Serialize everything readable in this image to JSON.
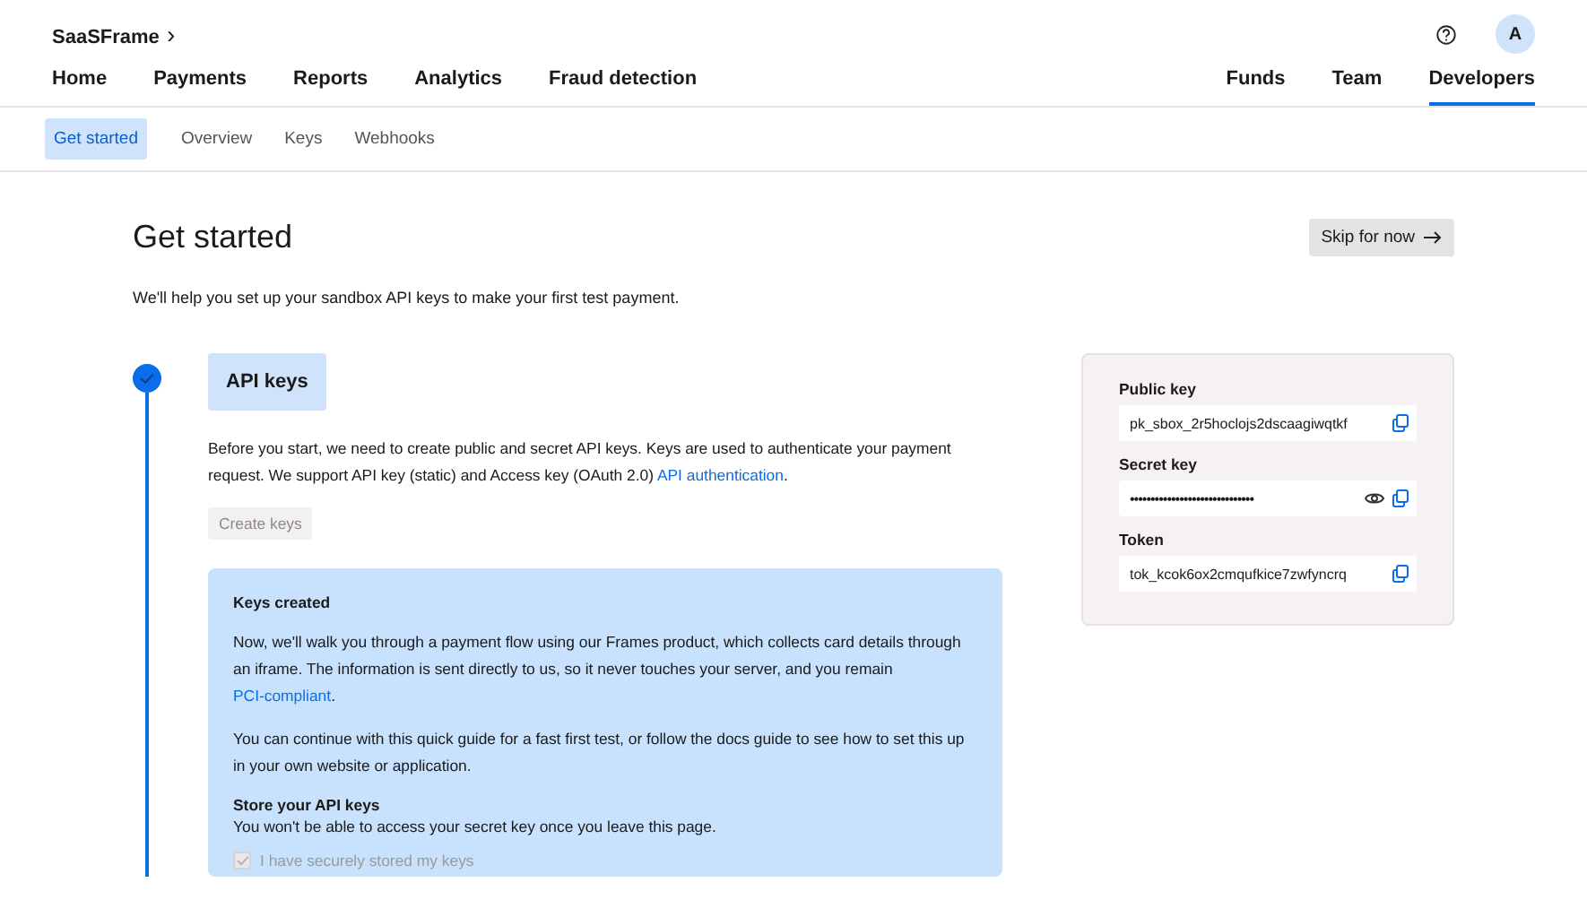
{
  "brand": {
    "name": "SaaSFrame",
    "chevron": "›"
  },
  "avatar": {
    "initial": "A"
  },
  "nav_left": [
    {
      "label": "Home",
      "selected": false
    },
    {
      "label": "Payments",
      "selected": false
    },
    {
      "label": "Reports",
      "selected": false
    },
    {
      "label": "Analytics",
      "selected": false
    },
    {
      "label": "Fraud detection",
      "selected": false
    }
  ],
  "nav_right": [
    {
      "label": "Funds",
      "selected": false
    },
    {
      "label": "Team",
      "selected": false
    },
    {
      "label": "Developers",
      "selected": true
    }
  ],
  "subnav": [
    {
      "label": "Get started",
      "selected": true
    },
    {
      "label": "Overview",
      "selected": false
    },
    {
      "label": "Keys",
      "selected": false
    },
    {
      "label": "Webhooks",
      "selected": false
    }
  ],
  "page": {
    "title": "Get started",
    "subtitle": "We'll help you set up your sandbox API keys to make your first test payment.",
    "skip_button": "Skip for now"
  },
  "step": {
    "title": "API keys",
    "completed": true,
    "intro": "Before you start, we need to create public and secret API keys. Keys are used to authenticate your payment request. We support API key (static) and Access key (OAuth 2.0)",
    "intro_link": "API authentication",
    "intro_end": ".",
    "create_button": {
      "label": "Create keys",
      "disabled": true
    }
  },
  "notice": {
    "title": "Keys created",
    "para1": "Now, we'll walk you through a payment flow using our Frames product, which collects card details through an iframe. The information is sent directly to us, so it never touches your server, and you remain",
    "para1_link": "PCI-compliant",
    "para1_end": ".",
    "para2": "You can continue with this quick guide for a fast first test, or follow the docs guide to see how to set this up in your own website or application.",
    "store_title": "Store your API keys",
    "store_text": "You won't be able to access your secret key once you leave this page.",
    "checkbox": {
      "label": "I have securely stored my keys",
      "checked": true,
      "disabled": true
    }
  },
  "keys": [
    {
      "label": "Public key",
      "value": "pk_sbox_2r5hoclojs2dscaagiwqtkf",
      "masked": false
    },
    {
      "label": "Secret key",
      "value": "••••••••••••••••••••••••••••••",
      "masked": true
    },
    {
      "label": "Token",
      "value": "tok_kcok6ox2cmqufkice7zwfyncrq",
      "masked": false
    }
  ]
}
